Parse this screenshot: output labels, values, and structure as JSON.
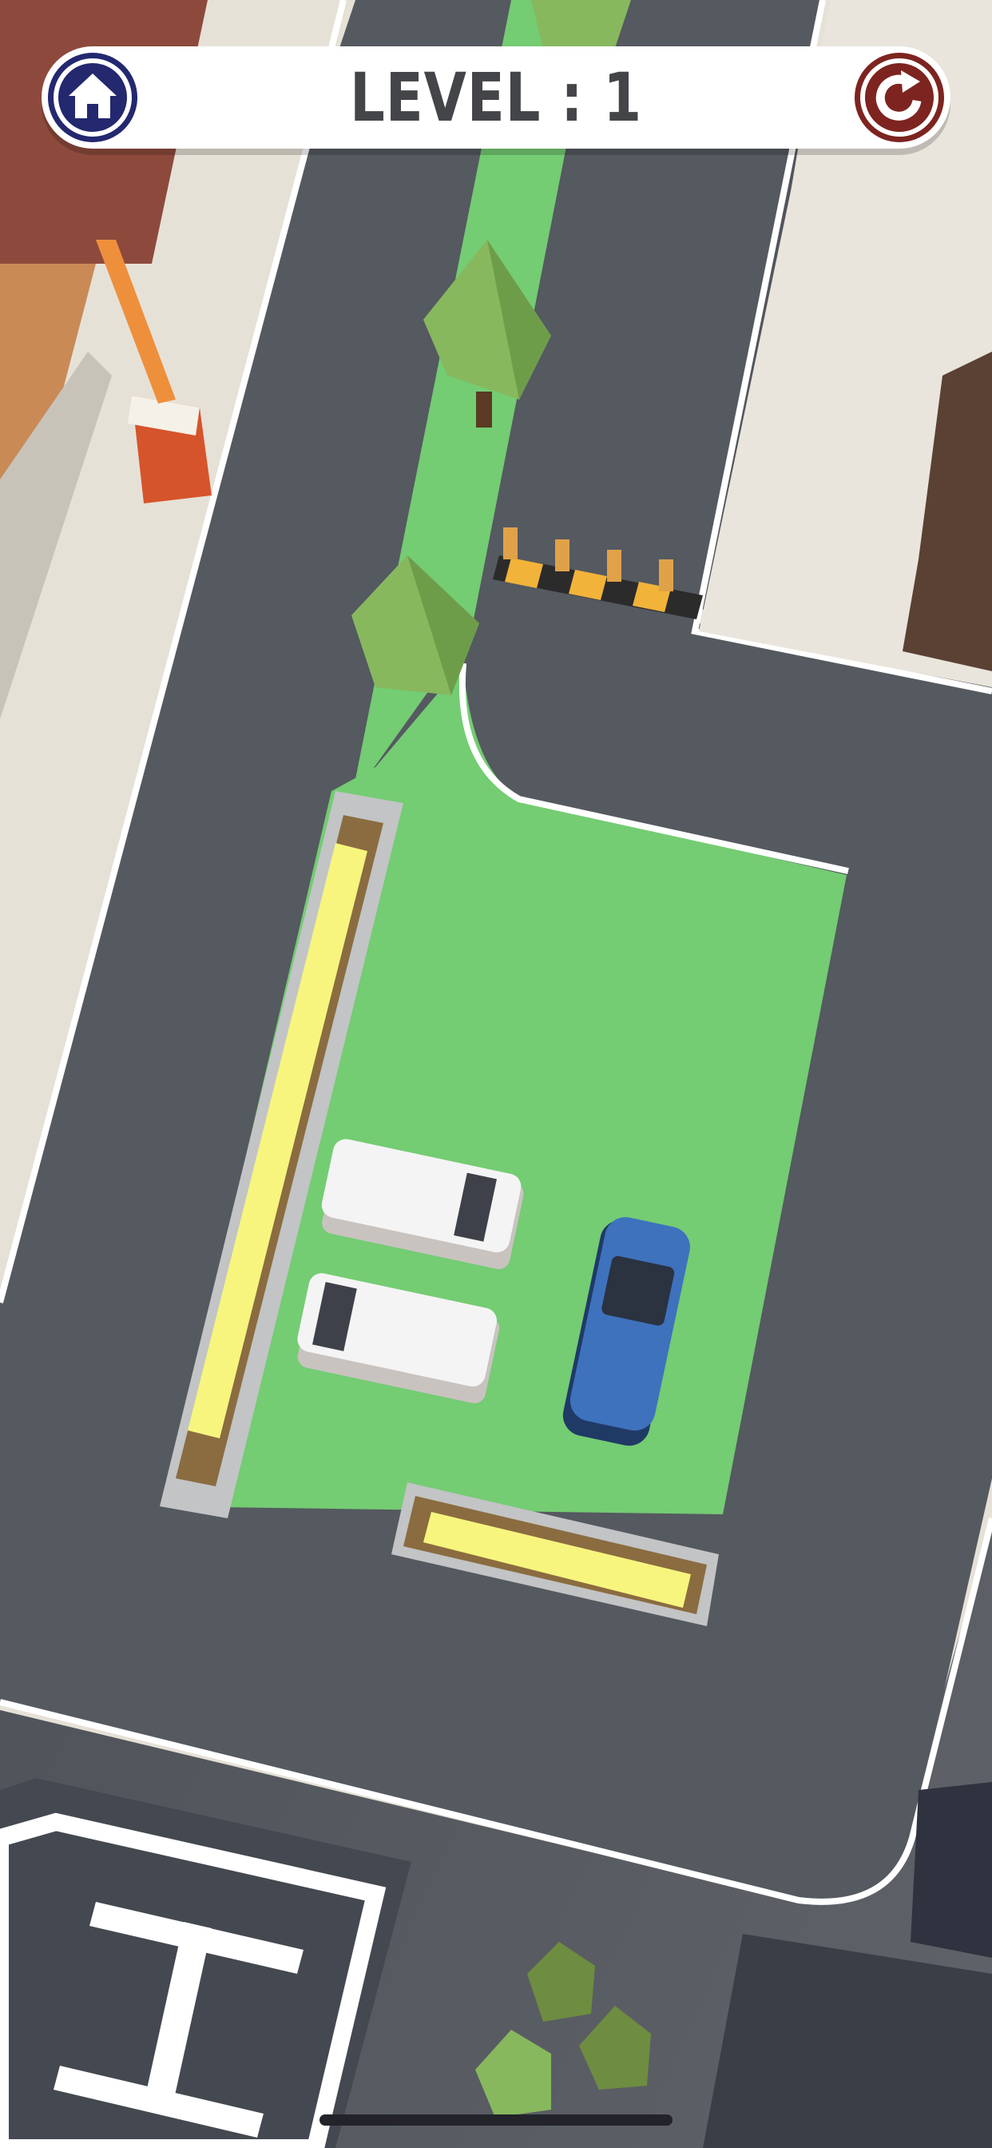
{
  "hud": {
    "level_label": "LEVEL : 1",
    "home_icon": "home-icon",
    "restart_icon": "restart-icon"
  },
  "scene": {
    "vehicles": [
      {
        "name": "white-van-top",
        "color": "#f4f4f4"
      },
      {
        "name": "white-van-bottom",
        "color": "#f4f4f4"
      },
      {
        "name": "blue-car",
        "color": "#3e72bd"
      }
    ],
    "helipad_letter": "H"
  },
  "colors": {
    "road": "#54585f",
    "grass": "#74cc73",
    "sidewalk": "#e6e1d7",
    "planter": "#f7f57e",
    "home_button": "#23286f",
    "restart_button": "#7d2420"
  }
}
